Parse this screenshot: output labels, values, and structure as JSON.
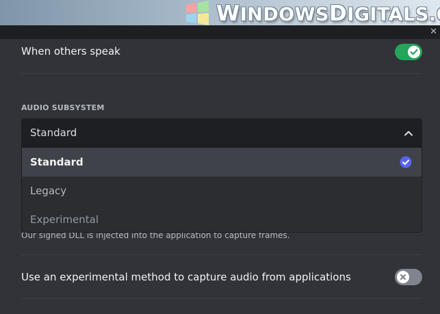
{
  "watermark": {
    "text": "WindowsDigitals.com"
  },
  "settings": {
    "others_speak": {
      "label": "When others speak",
      "enabled": true
    },
    "audio_subsystem": {
      "label": "AUDIO SUBSYSTEM",
      "selected": "Standard",
      "options": [
        {
          "label": "Standard",
          "selected": true
        },
        {
          "label": "Legacy",
          "selected": false
        },
        {
          "label": "Experimental",
          "selected": false
        }
      ]
    },
    "capture_description": "Our signed DLL is injected into the application to capture frames.",
    "experimental_capture": {
      "label": "Use an experimental method to capture audio from applications",
      "enabled": false
    }
  },
  "colors": {
    "toggle_on": "#23a55a",
    "toggle_off": "#80848e",
    "accent": "#5865f2",
    "background": "#313338"
  },
  "icons": {
    "check": "check-icon",
    "close": "x-icon",
    "chevron": "chevron-up-icon"
  }
}
